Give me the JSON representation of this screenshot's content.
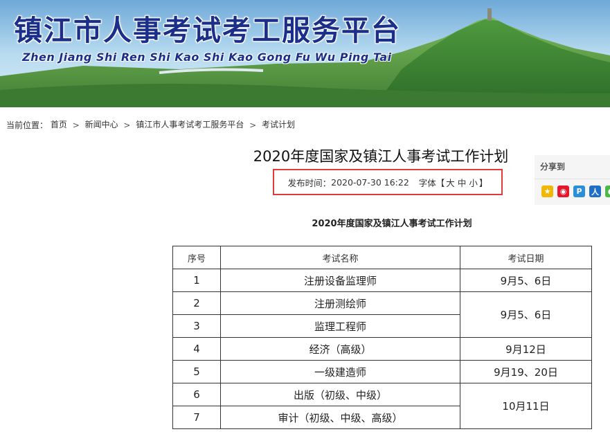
{
  "banner": {
    "title": "镇江市人事考试考工服务平台",
    "subtitle": "Zhen Jiang Shi Ren Shi Kao Shi Kao Gong Fu Wu Ping Tai"
  },
  "breadcrumb": {
    "label": "当前位置：",
    "items": [
      "首页",
      "新闻中心",
      "镇江市人事考试考工服务平台",
      "考试计划"
    ],
    "separator": ">"
  },
  "article": {
    "title": "2020年度国家及镇江人事考试工作计划",
    "publish_label": "发布时间：",
    "publish_time": "2020-07-30 16:22",
    "font_label": "字体【",
    "font_large": "大",
    "font_medium": "中",
    "font_small": "小",
    "font_close": "】",
    "subtitle": "2020年度国家及镇江人事考试工作计划"
  },
  "share": {
    "label": "分享到",
    "icons": [
      "qzone-icon",
      "weibo-icon",
      "tencent-weibo-icon",
      "renren-icon",
      "wechat-icon"
    ]
  },
  "table": {
    "headers": [
      "序号",
      "考试名称",
      "考试日期"
    ],
    "rows": [
      {
        "no": "1",
        "name": "注册设备监理师",
        "date": "9月5、6日"
      },
      {
        "no": "2",
        "name": "注册测绘师",
        "date": "9月5、6日"
      },
      {
        "no": "3",
        "name": "监理工程师",
        "date": ""
      },
      {
        "no": "4",
        "name": "经济（高级）",
        "date": "9月12日"
      },
      {
        "no": "5",
        "name": "一级建造师",
        "date": "9月19、20日"
      },
      {
        "no": "6",
        "name": "出版（初级、中级）",
        "date": "10月11日"
      },
      {
        "no": "7",
        "name": "审计（初级、中级、高级）",
        "date": ""
      }
    ]
  },
  "colors": {
    "title_blue": "#1b2f8a",
    "highlight_red": "#e03a3a"
  }
}
